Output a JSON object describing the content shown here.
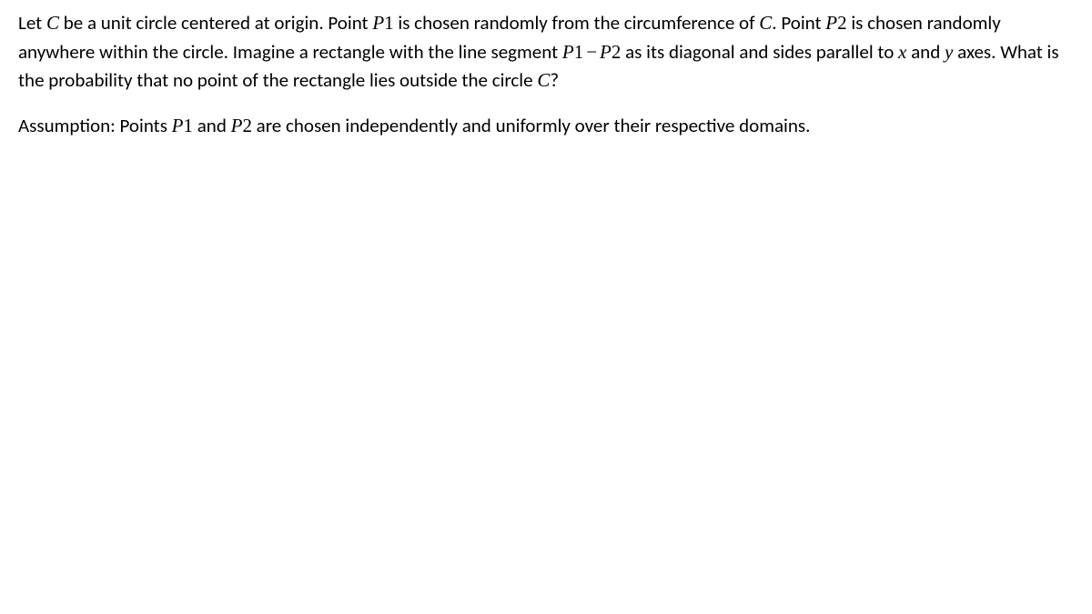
{
  "para1": {
    "t1": "Let ",
    "v1": "C",
    "t2": " be a unit circle centered at origin. Point ",
    "v2": "P",
    "n2": "1",
    "t3": " is chosen randomly from the circumference of ",
    "v3": "C",
    "t4": ".  Point ",
    "v4": "P",
    "n4": "2",
    "t5": " is chosen randomly anywhere within the circle. Imagine a rectangle with the line segment ",
    "v5": "P",
    "n5": "1",
    "op": "−",
    "v6": "P",
    "n6": "2",
    "t6": " as its diagonal and sides parallel to ",
    "v7": "x",
    "t7": " and ",
    "v8": "y",
    "t8": " axes. What is the probability that no point of the rectangle lies outside the circle ",
    "v9": "C",
    "t9": "?"
  },
  "para2": {
    "t1": "Assumption: Points ",
    "v1": "P",
    "n1": "1",
    "t2": " and ",
    "v2": "P",
    "n2": "2",
    "t3": " are chosen independently and uniformly over their respective domains."
  }
}
